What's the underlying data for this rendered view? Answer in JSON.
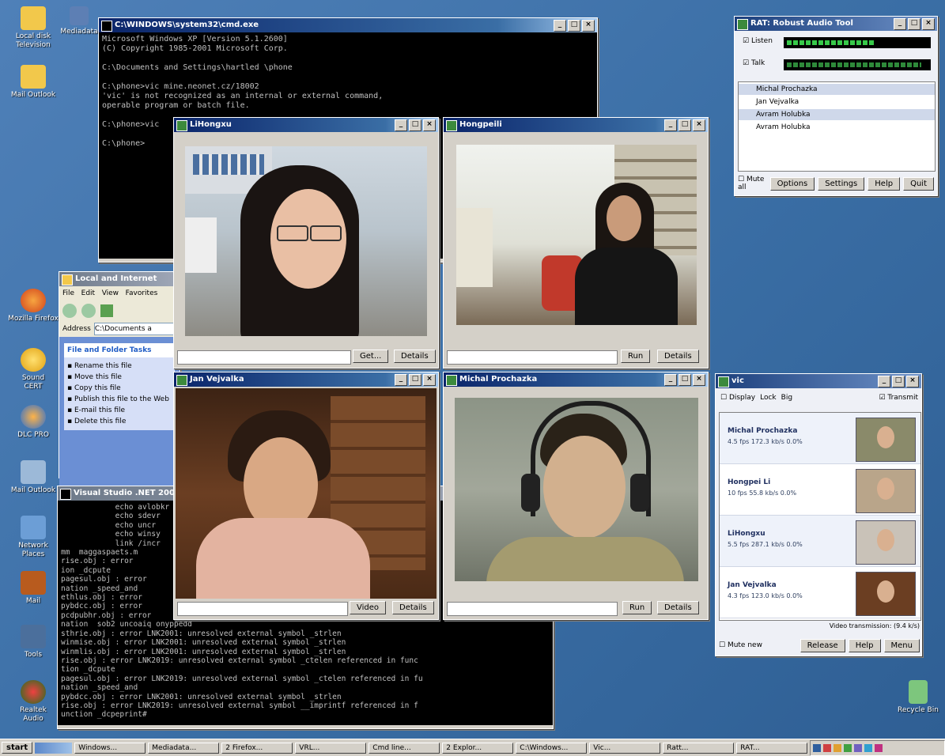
{
  "desktop": {
    "icons": [
      {
        "label": "Local disk\nTelevision"
      },
      {
        "label": "Mediadata"
      },
      {
        "label": "Mozilla Firefox"
      },
      {
        "label": "Sound\nCERT"
      },
      {
        "label": "DLC PRO"
      },
      {
        "label": "Mail Outlook"
      },
      {
        "label": "Network\nPlaces"
      },
      {
        "label": "Mail"
      },
      {
        "label": "Tools"
      },
      {
        "label": "Realtek\nAudio"
      },
      {
        "label": "Recycle Bin"
      }
    ]
  },
  "console_top": {
    "title": "C:\\WINDOWS\\system32\\cmd.exe",
    "lines": [
      "Microsoft Windows XP [Version 5.1.2600]",
      "(C) Copyright 1985-2001 Microsoft Corp.",
      "",
      "C:\\Documents and Settings\\hartled \\phone",
      "",
      "C:\\phone>vic mine.neonet.cz/18002",
      "'vic' is not recognized as an internal or external command,",
      "operable program or batch file.",
      "",
      "C:\\phone>vic",
      "",
      "C:\\phone>"
    ]
  },
  "explorer": {
    "title": "Local and Internet",
    "menu": [
      "File",
      "Edit",
      "View",
      "Favorites"
    ],
    "address_label": "Address",
    "address_value": "C:\\Documents a",
    "tasks_title": "File and Folder Tasks",
    "tasks": [
      "Rename this file",
      "Move this file",
      "Copy this file",
      "Publish this file to the Web",
      "E-mail this file",
      "Delete this file"
    ]
  },
  "console_bottom": {
    "title": "Visual Studio .NET 2003",
    "lines": [
      "            echo avlobkr",
      "            echo sdevr",
      "            echo uncr",
      "            echo winsy",
      "            link /incr",
      "mm  maggaspaets.m",
      "rise.obj : error",
      "ion _dcpute",
      "pagesul.obj : error",
      "nation _speed_and",
      "ethlus.obj : error",
      "pybdcc.obj : error",
      "pcdpubhr.obj : error",
      "nation  sob2 uncoaiq onyppedd",
      "sthrie.obj : error LNK2001: unresolved external symbol _strlen",
      "winmise.obj : error LNK2001: unresolved external symbol _strlen",
      "winmlis.obj : error LNK2001: unresolved external symbol _strlen",
      "rise.obj : error LNK2019: unresolved external symbol _ctelen referenced in func",
      "tion _dcpute",
      "pagesul.obj : error LNK2019: unresolved external symbol _ctelen referenced in fu",
      "nation _speed_and",
      "pybdcc.obj : error LNK2001: unresolved external symbol _strlen",
      "rise.obj : error LNK2019: unresolved external symbol __imprintf referenced in f",
      "unction _dcpeprint#"
    ]
  },
  "video_windows": [
    {
      "title": "LiHongxu",
      "btn1": "Get...",
      "btn2": "Details"
    },
    {
      "title": "Hongpeili",
      "btn1": "Run",
      "btn2": "Details"
    },
    {
      "title": "Jan Vejvalka",
      "btn1": "Video",
      "btn2": "Details"
    },
    {
      "title": "Michal Prochazka",
      "btn1": "Run",
      "btn2": "Details"
    }
  ],
  "rat": {
    "title": "RAT: Robust Audio Tool",
    "row1": "Listen",
    "row2": "Talk",
    "participants": [
      "Michal Prochazka",
      "Jan Vejvalka",
      "Avram Holubka",
      "Avram Holubka"
    ],
    "mute": "Mute all",
    "buttons": [
      "Options",
      "Settings",
      "Help",
      "Quit"
    ]
  },
  "vic": {
    "title": "vic",
    "top_checks": [
      "Display",
      "Lock",
      "Big",
      "Transmit"
    ],
    "participants": [
      {
        "name": "Michal Prochazka",
        "stats": "4.5 fps  172.3 kb/s  0.0%"
      },
      {
        "name": "Hongpei Li",
        "stats": "10 fps  55.8 kb/s  0.0%"
      },
      {
        "name": "LiHongxu",
        "stats": "5.5 fps  287.1 kb/s  0.0%"
      },
      {
        "name": "Jan Vejvalka",
        "stats": "4.3 fps  123.0 kb/s  0.0%"
      }
    ],
    "footer_note": "Video transmission: (9.4 k/s)",
    "mute": "Mute new",
    "buttons": [
      "Release",
      "Help",
      "Menu"
    ]
  },
  "taskbar": {
    "start": "start",
    "tasks": [
      "Windows...",
      "Mediadata...",
      "2 Firefox...",
      "VRL...",
      "Cmd line...",
      "2 Explor...",
      "C:\\Windows...",
      "Vic...",
      "Ratt...",
      "RAT..."
    ]
  }
}
